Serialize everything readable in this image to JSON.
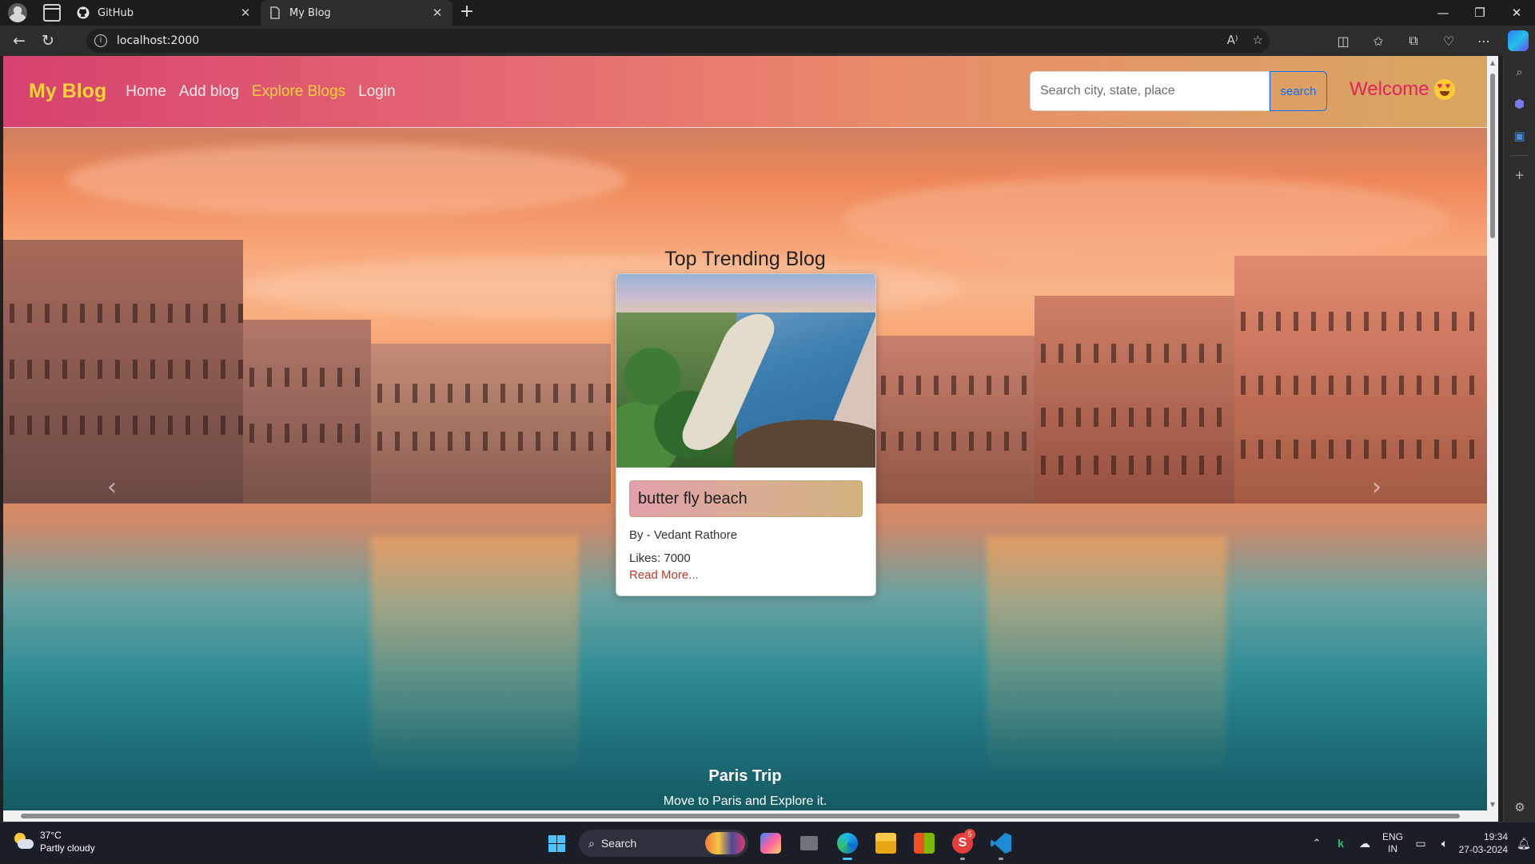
{
  "browser": {
    "tabs": [
      {
        "title": "GitHub",
        "icon": "github-icon",
        "active": false
      },
      {
        "title": "My Blog",
        "icon": "page-icon",
        "active": true
      }
    ],
    "new_tab": "+",
    "window_controls": {
      "minimize": "—",
      "restore": "❐",
      "close": "✕"
    },
    "address": "localhost:2000"
  },
  "site": {
    "brand": "My Blog",
    "nav": [
      {
        "label": "Home",
        "active": false
      },
      {
        "label": "Add blog",
        "active": false
      },
      {
        "label": "Explore Blogs",
        "active": true
      },
      {
        "label": "Login",
        "active": false
      }
    ],
    "search": {
      "placeholder": "Search city, state, place",
      "button": "search"
    },
    "welcome": "Welcome",
    "colors": {
      "brand": "#ffd23a",
      "welcome": "#e0245e",
      "link_active": "#ffd23a",
      "read_more": "#c0392b"
    }
  },
  "trending": {
    "heading": "Top Trending Blog",
    "card": {
      "title": "butter fly beach",
      "author": "By - Vedant Rathore",
      "likes": "Likes: 7000",
      "read_more": "Read More..."
    }
  },
  "carousel": {
    "caption_title": "Paris Trip",
    "caption_text": "Move to Paris and Explore it."
  },
  "taskbar": {
    "weather": {
      "temp": "37°C",
      "condition": "Partly cloudy"
    },
    "search": "Search",
    "language": {
      "line1": "ENG",
      "line2": "IN"
    },
    "time": "19:34",
    "date": "27-03-2024",
    "skype_badge": "5"
  }
}
